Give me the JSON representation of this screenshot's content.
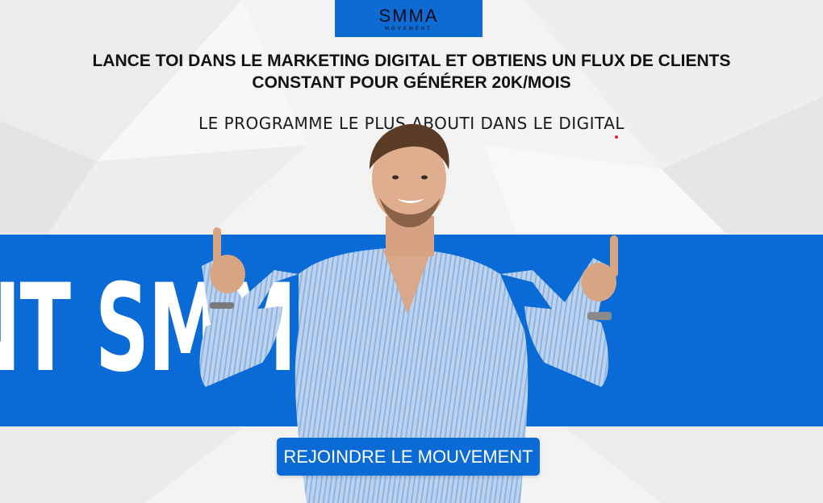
{
  "logo": {
    "word": "SMMA",
    "sub": "MOVEMENT"
  },
  "hero": {
    "headline_line1": "LANCE TOI DANS LE MARKETING DIGITAL ET OBTIENS UN FLUX DE CLIENTS",
    "headline_line2": "CONSTANT POUR GÉNÉRER 20K/MOIS",
    "subheadline": "LE PROGRAMME LE PLUS ABOUTI DANS LE DIGITAL"
  },
  "band": {
    "text": "NT SMM"
  },
  "cta": {
    "label": "REJOINDRE LE MOUVEMENT"
  },
  "colors": {
    "brand_blue": "#0a6ad6",
    "background": "#f4f4f5",
    "text_dark": "#111111",
    "accent_red": "#e02424"
  }
}
